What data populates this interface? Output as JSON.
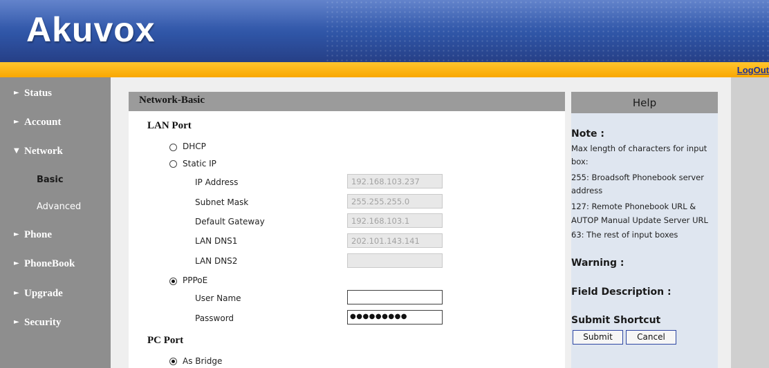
{
  "brand": {
    "logo_text": "Akuvox"
  },
  "logout_label": "LogOut",
  "sidebar": {
    "items": [
      {
        "label": "Status",
        "arrow": "►"
      },
      {
        "label": "Account",
        "arrow": "►"
      },
      {
        "label": "Network",
        "arrow": "▼"
      },
      {
        "label": "Phone",
        "arrow": "►"
      },
      {
        "label": "PhoneBook",
        "arrow": "►"
      },
      {
        "label": "Upgrade",
        "arrow": "►"
      },
      {
        "label": "Security",
        "arrow": "►"
      }
    ],
    "network_subitems": [
      {
        "label": "Basic",
        "active": true
      },
      {
        "label": "Advanced",
        "active": false
      }
    ]
  },
  "panel": {
    "title": "Network-Basic",
    "lan_port": {
      "heading": "LAN Port",
      "options": [
        {
          "label": "DHCP",
          "selected": false
        },
        {
          "label": "Static IP",
          "selected": false
        },
        {
          "label": "PPPoE",
          "selected": true
        }
      ],
      "static_fields": [
        {
          "label": "IP Address",
          "value": "192.168.103.237"
        },
        {
          "label": "Subnet Mask",
          "value": "255.255.255.0"
        },
        {
          "label": "Default Gateway",
          "value": "192.168.103.1"
        },
        {
          "label": "LAN DNS1",
          "value": "202.101.143.141"
        },
        {
          "label": "LAN DNS2",
          "value": ""
        }
      ],
      "pppoe_fields": [
        {
          "label": "User Name",
          "value": ""
        },
        {
          "label": "Password",
          "value": "●●●●●●●●●"
        }
      ]
    },
    "pc_port": {
      "heading": "PC Port",
      "options": [
        {
          "label": "As Bridge",
          "selected": true
        }
      ]
    }
  },
  "help": {
    "title": "Help",
    "note_heading": "Note :",
    "note_lines": [
      "Max length of characters for input",
      "box:",
      "255: Broadsoft Phonebook server",
      "address",
      "127: Remote Phonebook URL &",
      "AUTOP Manual Update Server URL",
      "63: The rest of input boxes"
    ],
    "warning_heading": "Warning :",
    "field_description_heading": "Field Description :",
    "submit_shortcut_heading": "Submit Shortcut",
    "submit_label": "Submit",
    "cancel_label": "Cancel"
  },
  "colors": {
    "header_blue": "#2f55a6",
    "orange_bar": "#f9a700",
    "sidebar_gray": "#8e8e8e",
    "panel_header_gray": "#9b9b9b",
    "help_background": "#dfe6f0",
    "active_submenu_text": "#1a1a1a",
    "inactive_submenu_text": "#ffffff",
    "logout_link": "#1b2f96"
  }
}
